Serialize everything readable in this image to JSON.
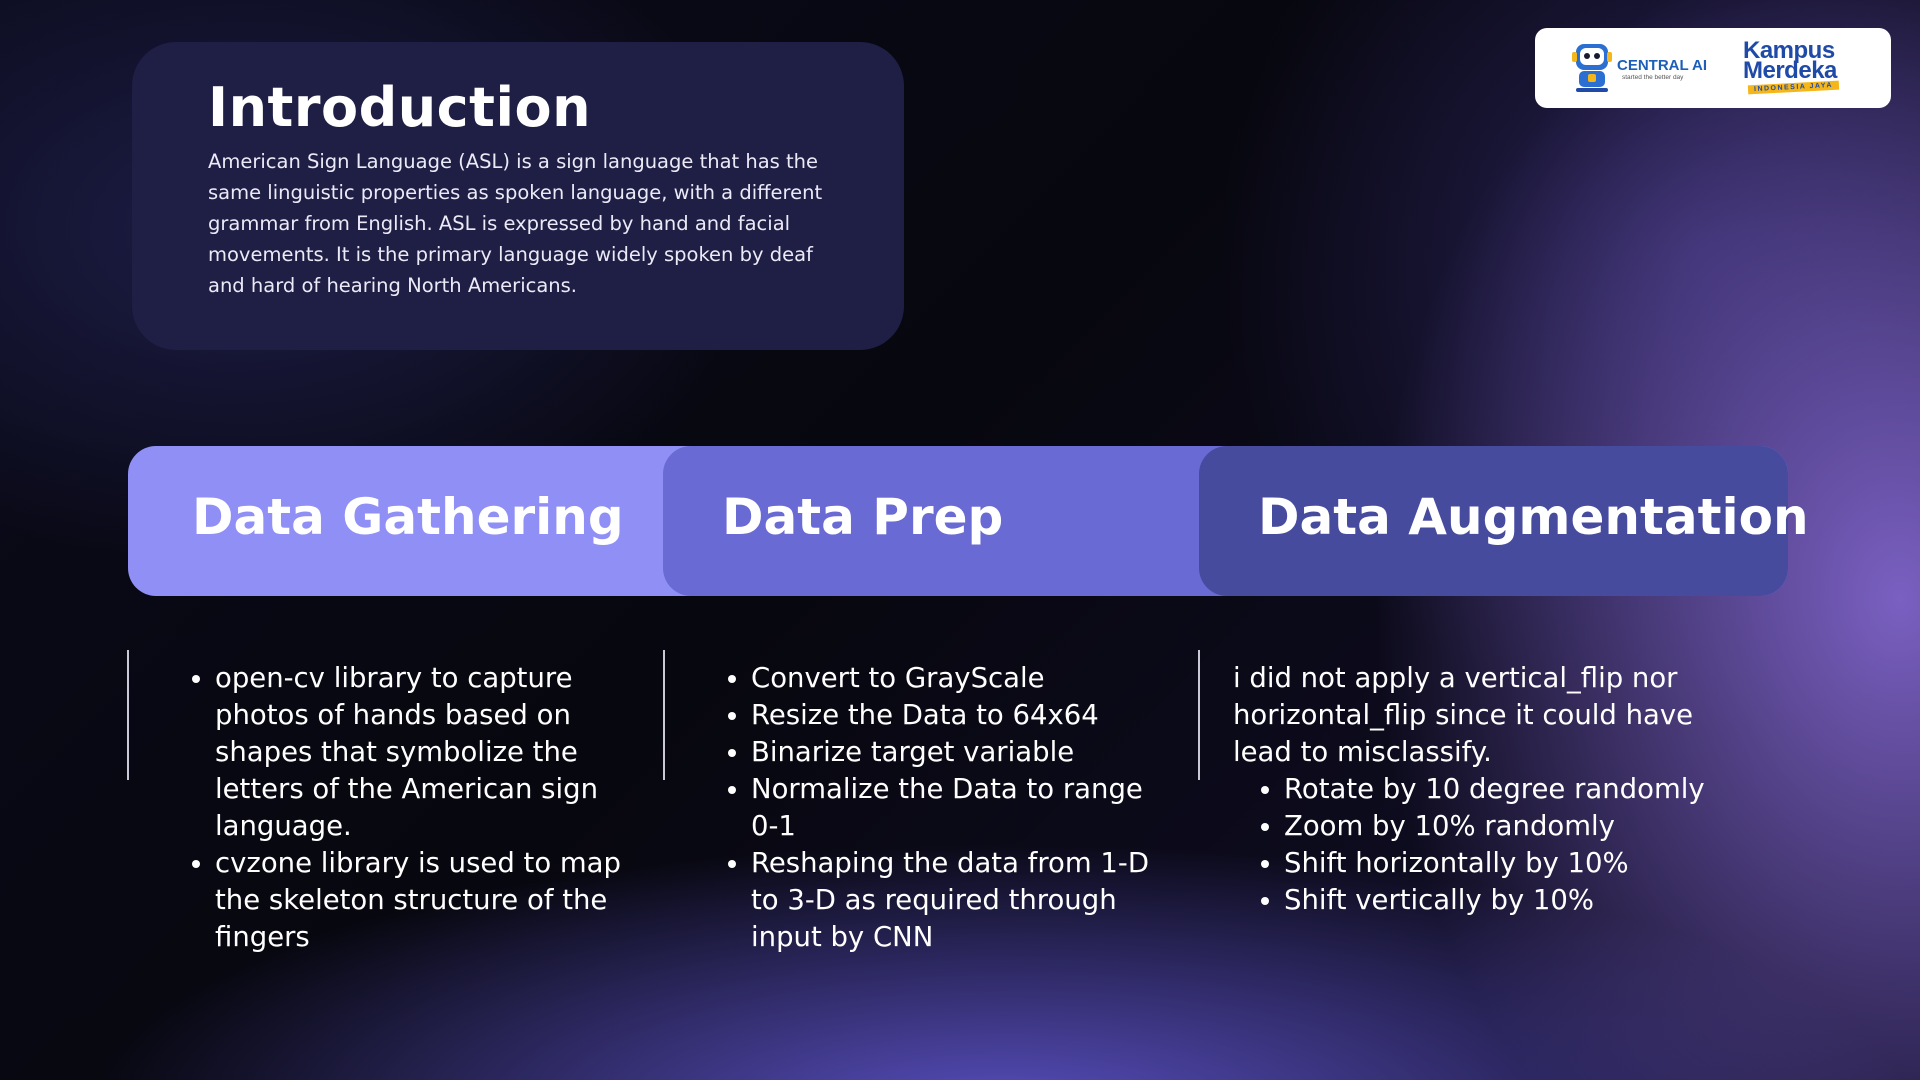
{
  "intro": {
    "title": "Introduction",
    "body": "American Sign Language (ASL) is a sign language that has the same linguistic properties as spoken language, with a different grammar from English. ASL is expressed by hand and facial movements. It is the primary language widely spoken by deaf and hard of hearing North Americans."
  },
  "logos": {
    "central_ai": "CENTRAL AI",
    "central_ai_tagline": "started the better day",
    "kampus_line1": "Kampus",
    "kampus_line2": "Merdeka",
    "kampus_sub": "INDONESIA JAYA"
  },
  "sections": [
    {
      "title": "Data Gathering",
      "items": [
        "open-cv library to capture photos of hands based on shapes that symbolize the letters of the American sign language.",
        "cvzone library is used to map the skeleton structure of the fingers"
      ]
    },
    {
      "title": "Data Prep",
      "items": [
        "Convert to GrayScale",
        "Resize the Data to 64x64",
        "Binarize target variable",
        "Normalize the Data to range 0-1",
        "Reshaping the data from 1-D to 3-D as required through input by CNN"
      ]
    },
    {
      "title": "Data Augmentation",
      "intro": "i did not apply a vertical_flip nor horizontal_flip since it could have lead to misclassify.",
      "items": [
        "Rotate by 10 degree randomly",
        "Zoom by 10% randomly",
        "Shift horizontally by 10%",
        "Shift vertically by 10%"
      ]
    }
  ]
}
